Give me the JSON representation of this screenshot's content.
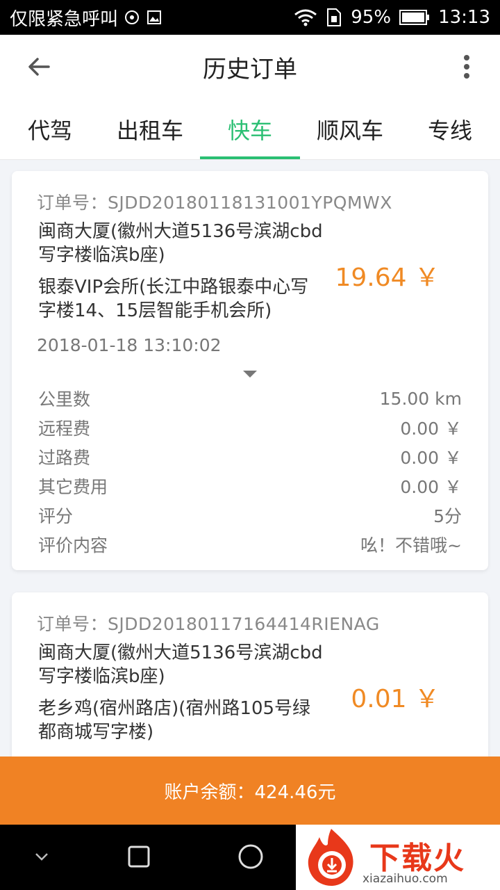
{
  "status_bar": {
    "carrier": "仅限紧急呼叫",
    "battery": "95%",
    "time": "13:13"
  },
  "header": {
    "title": "历史订单"
  },
  "tabs": [
    {
      "label": "代驾",
      "active": false
    },
    {
      "label": "出租车",
      "active": false
    },
    {
      "label": "快车",
      "active": true
    },
    {
      "label": "顺风车",
      "active": false
    },
    {
      "label": "专线",
      "active": false
    }
  ],
  "orders": [
    {
      "order_no": "订单号：SJDD20180118131001YPQMWX",
      "from": "闽商大厦(徽州大道5136号滨湖cbd写字楼临滨b座)",
      "to": "银泰VIP会所(长江中路银泰中心写字楼14、15层智能手机会所)",
      "price": "19.64 ￥",
      "date": "2018-01-18 13:10:02",
      "details": [
        {
          "label": "公里数",
          "value": "15.00 km"
        },
        {
          "label": "远程费",
          "value": "0.00 ￥"
        },
        {
          "label": "过路费",
          "value": "0.00 ￥"
        },
        {
          "label": "其它费用",
          "value": "0.00 ￥"
        },
        {
          "label": "评分",
          "value": "5分"
        },
        {
          "label": "评价内容",
          "value": "吆！不错哦~"
        }
      ]
    },
    {
      "order_no": "订单号：SJDD20180117164414RIENAG",
      "from": "闽商大厦(徽州大道5136号滨湖cbd写字楼临滨b座)",
      "to": "老乡鸡(宿州路店)(宿州路105号绿都商城写字楼)",
      "price": "0.01 ￥"
    }
  ],
  "balance": {
    "label": "账户余额：424.46元"
  },
  "watermark": {
    "brand": "下载火",
    "site": "xiazaihuo.com"
  },
  "colors": {
    "accent": "#2bbf73",
    "price": "#f08a24",
    "balance_bar": "#f08224"
  }
}
